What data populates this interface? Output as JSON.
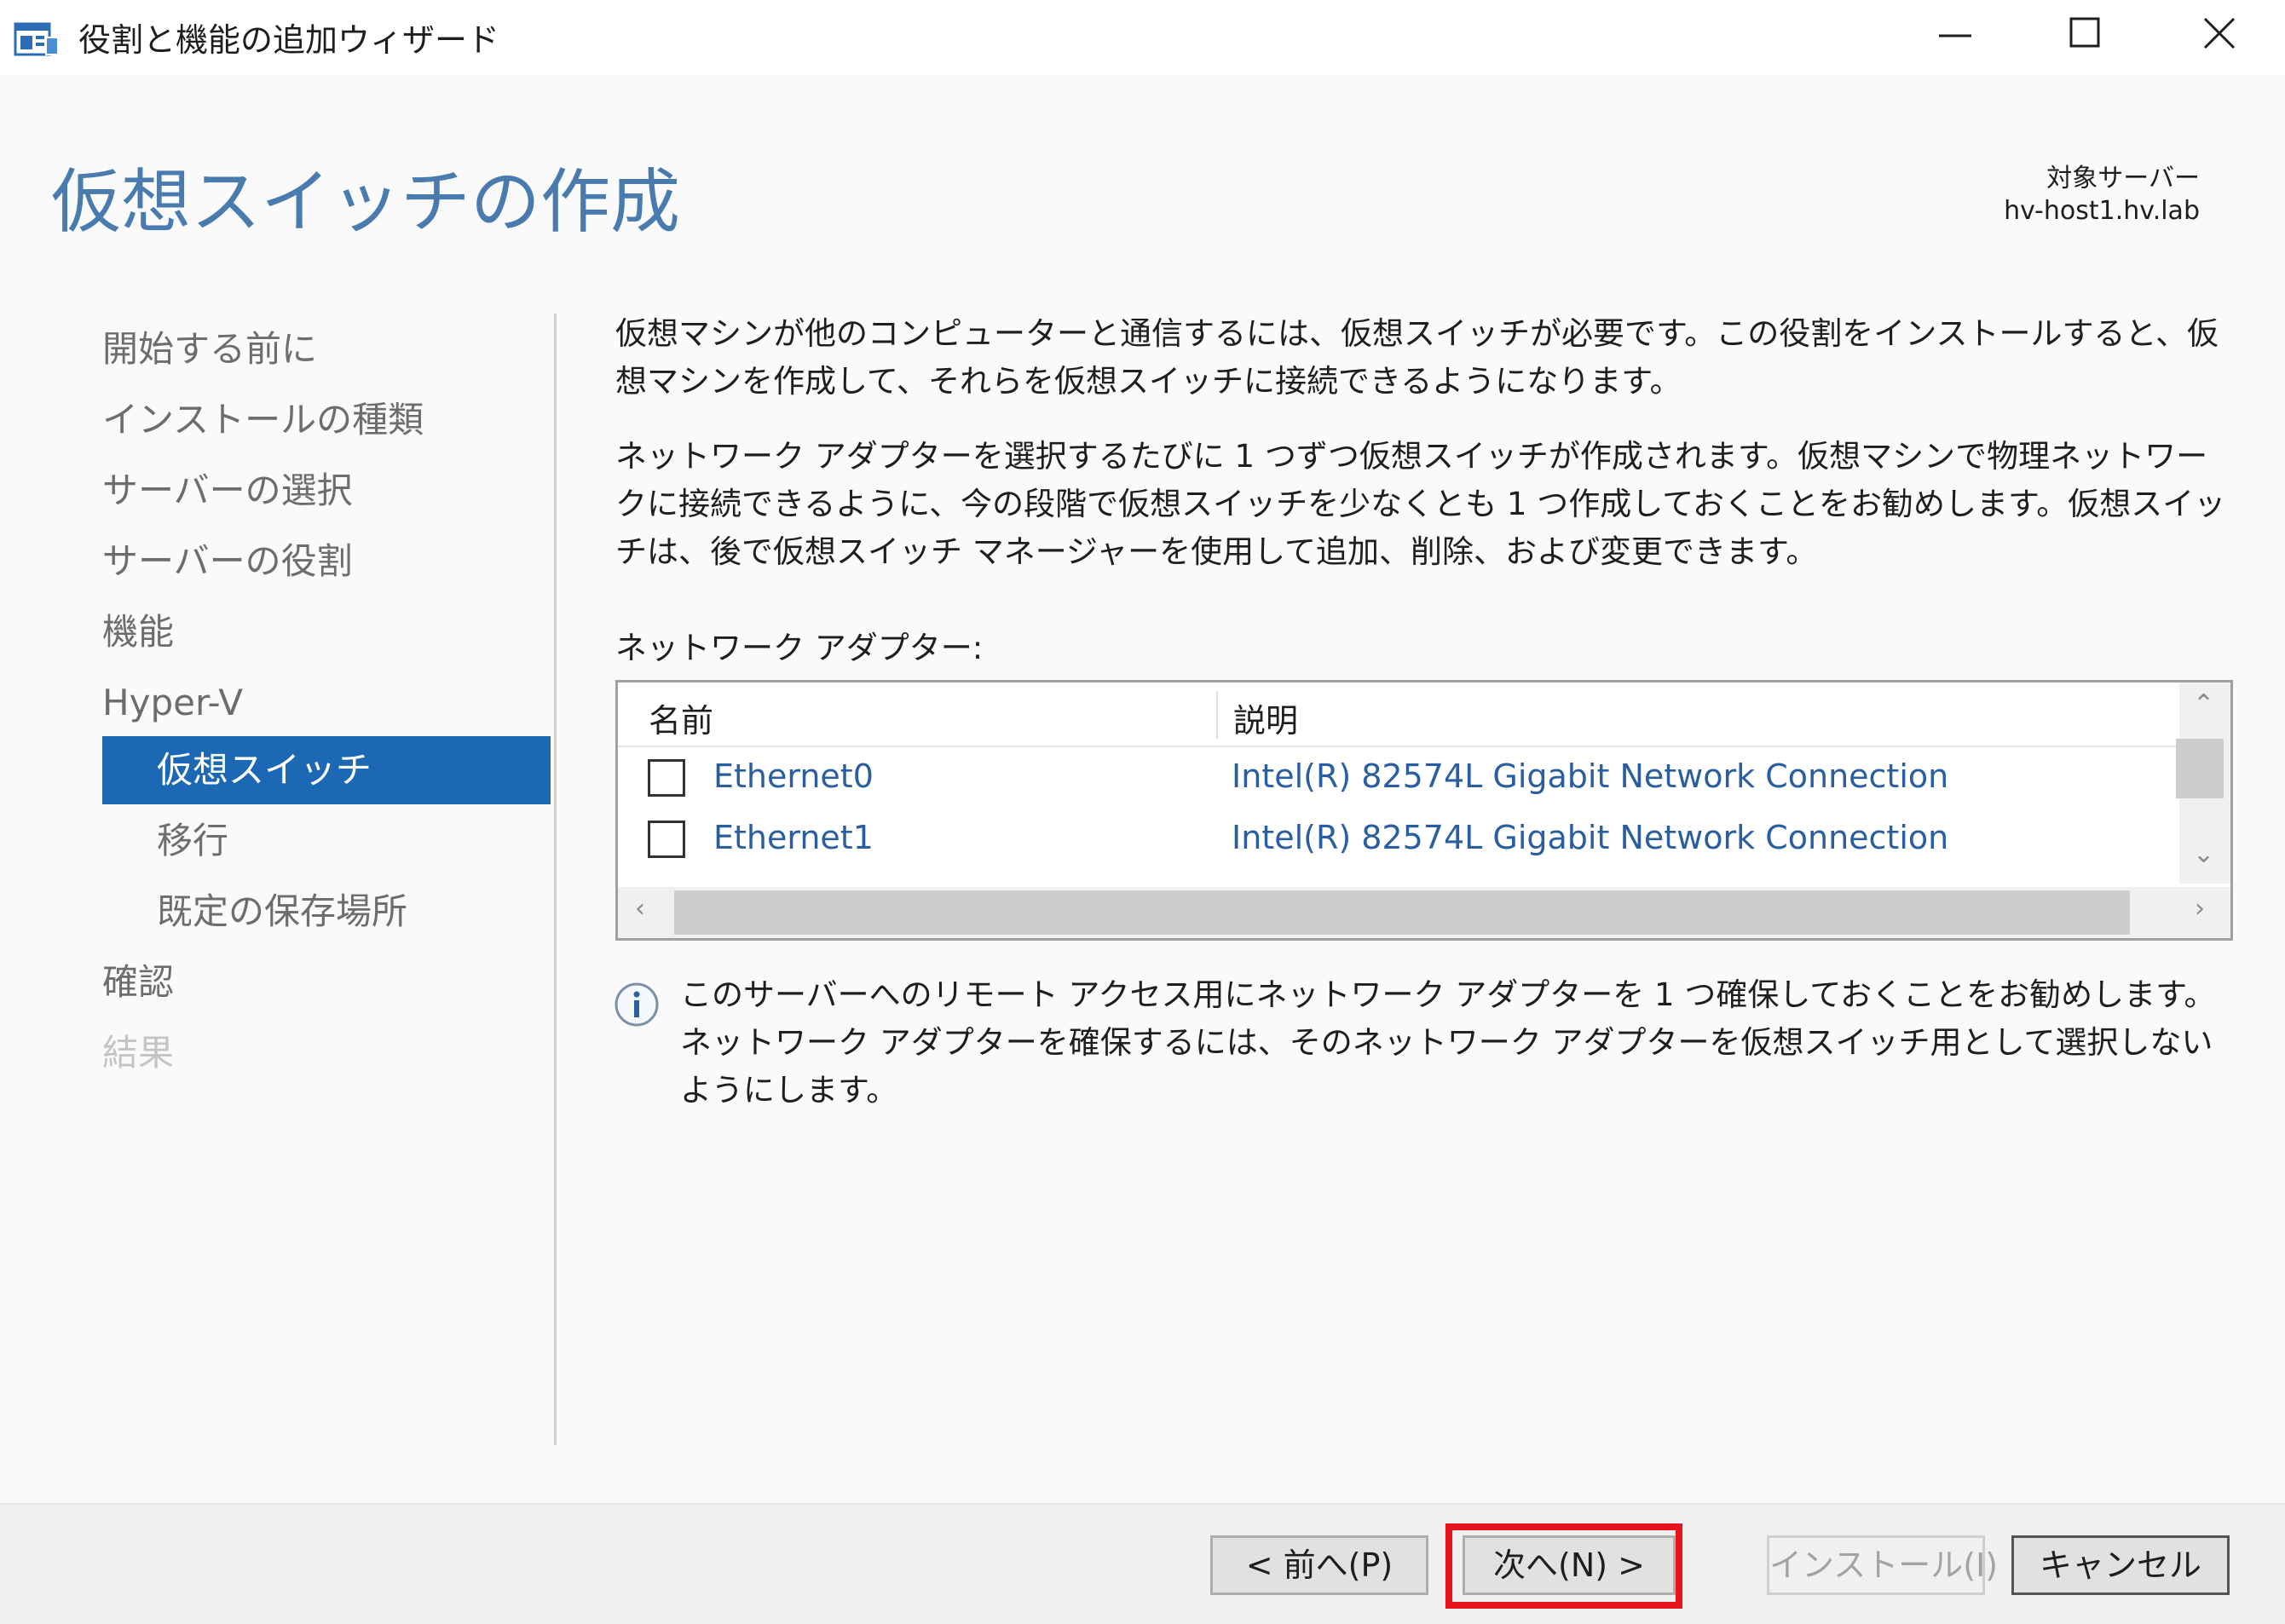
{
  "window": {
    "title": "役割と機能の追加ウィザード",
    "controls": [
      "minimize",
      "maximize",
      "close"
    ]
  },
  "header": {
    "page_title": "仮想スイッチの作成",
    "target_label": "対象サーバー",
    "target_value": "hv-host1.hv.lab"
  },
  "nav": {
    "items": [
      {
        "label": "開始する前に",
        "state": "normal",
        "indent": 0
      },
      {
        "label": "インストールの種類",
        "state": "normal",
        "indent": 0
      },
      {
        "label": "サーバーの選択",
        "state": "normal",
        "indent": 0
      },
      {
        "label": "サーバーの役割",
        "state": "normal",
        "indent": 0
      },
      {
        "label": "機能",
        "state": "normal",
        "indent": 0
      },
      {
        "label": "Hyper-V",
        "state": "normal",
        "indent": 0
      },
      {
        "label": "仮想スイッチ",
        "state": "selected",
        "indent": 1
      },
      {
        "label": "移行",
        "state": "normal",
        "indent": 1
      },
      {
        "label": "既定の保存場所",
        "state": "normal",
        "indent": 1
      },
      {
        "label": "確認",
        "state": "normal",
        "indent": 0
      },
      {
        "label": "結果",
        "state": "disabled",
        "indent": 0
      }
    ]
  },
  "main": {
    "para1": "仮想マシンが他のコンピューターと通信するには、仮想スイッチが必要です。この役割をインストールすると、仮想マシンを作成して、それらを仮想スイッチに接続できるようになります。",
    "para2": "ネットワーク アダプターを選択するたびに 1 つずつ仮想スイッチが作成されます。仮想マシンで物理ネットワークに接続できるように、今の段階で仮想スイッチを少なくとも 1 つ作成しておくことをお勧めします。仮想スイッチは、後で仮想スイッチ マネージャーを使用して追加、削除、および変更できます。",
    "list_label": "ネットワーク アダプター:",
    "columns": {
      "name": "名前",
      "description": "説明"
    },
    "adapters": [
      {
        "name": "Ethernet0",
        "description": "Intel(R) 82574L Gigabit Network Connection",
        "checked": false
      },
      {
        "name": "Ethernet1",
        "description": "Intel(R) 82574L Gigabit Network Connection",
        "checked": false
      }
    ],
    "info_text": "このサーバーへのリモート アクセス用にネットワーク アダプターを 1 つ確保しておくことをお勧めします。ネットワーク アダプターを確保するには、そのネットワーク アダプターを仮想スイッチ用として選択しないようにします。"
  },
  "footer": {
    "back_label": "< 前へ(P)",
    "next_label": "次へ(N) >",
    "install_label": "インストール(I)",
    "cancel_label": "キャンセル"
  },
  "colors": {
    "accent": "#1c68b5",
    "title": "#4a7bae",
    "highlight": "#e8141b",
    "link_text": "#2a5ea0"
  }
}
